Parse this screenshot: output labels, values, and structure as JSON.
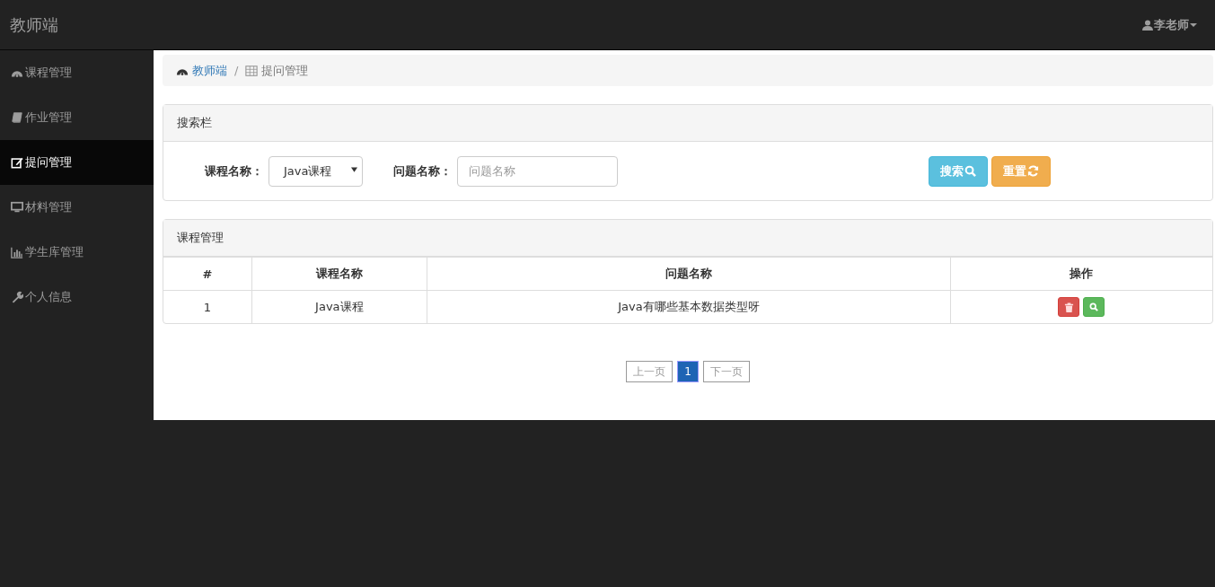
{
  "navbar": {
    "brand": "教师端",
    "user": "李老师"
  },
  "sidebar": {
    "items": [
      {
        "label": "课程管理",
        "selected": false
      },
      {
        "label": "作业管理",
        "selected": false
      },
      {
        "label": "提问管理",
        "selected": true
      },
      {
        "label": "材料管理",
        "selected": false
      },
      {
        "label": "学生库管理",
        "selected": false
      },
      {
        "label": "个人信息",
        "selected": false
      }
    ]
  },
  "breadcrumb": {
    "separator": "/",
    "items": [
      {
        "label": "教师端"
      },
      {
        "label": "提问管理"
      }
    ]
  },
  "search_panel": {
    "title": "搜索栏",
    "course_label": "课程名称：",
    "course_value": "Java课程",
    "question_label": "问题名称：",
    "question_placeholder": "问题名称",
    "search_button": "搜索",
    "reset_button": "重置"
  },
  "table_panel": {
    "title": "课程管理",
    "columns": [
      "#",
      "课程名称",
      "问题名称",
      "操作"
    ],
    "rows": [
      {
        "cells": [
          "1",
          "Java课程",
          "Java有哪些基本数据类型呀"
        ]
      }
    ]
  },
  "pagination": {
    "prev": "上一页",
    "pages": [
      {
        "label": "1",
        "selected": true
      }
    ],
    "next": "下一页"
  }
}
